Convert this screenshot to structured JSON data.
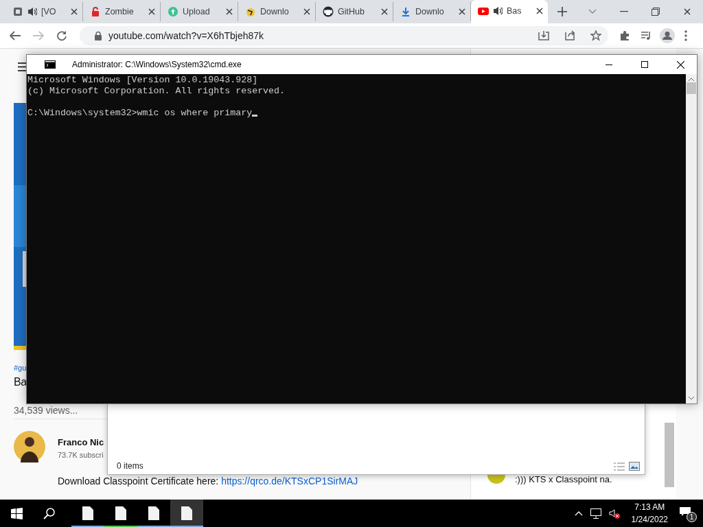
{
  "browser": {
    "tabs": [
      {
        "label": "[VO",
        "audio": true,
        "selected": false
      },
      {
        "label": "Zombie",
        "audio": false,
        "selected": false
      },
      {
        "label": "Upload",
        "audio": false,
        "selected": false
      },
      {
        "label": "Downlo",
        "audio": false,
        "selected": false
      },
      {
        "label": "GitHub",
        "audio": false,
        "selected": false
      },
      {
        "label": "Downlo",
        "audio": false,
        "selected": false
      },
      {
        "label": "Bas",
        "audio": true,
        "selected": true
      }
    ],
    "address": "youtube.com/watch?v=X6hTbjeh87k"
  },
  "page": {
    "hashtag": "#gu",
    "title": "Ba",
    "views": "34,539 views...",
    "channel": {
      "name": "Franco Nic",
      "subscribers": "73.7K subscri"
    },
    "description": [
      {
        "text": "Download Classpoint Certificate here: ",
        "link": "https://qrco.de/KTSxCP1SirMAJ"
      }
    ],
    "chat": {
      "message": ":))) KTS x Classpoint na."
    }
  },
  "cmd_window": {
    "title": "Administrator: C:\\Windows\\System32\\cmd.exe",
    "output_lines": [
      "Microsoft Windows [Version 10.0.19043.928]",
      "(c) Microsoft Corporation. All rights reserved."
    ],
    "prompt": "C:\\Windows\\system32>",
    "command": "wmic os where primary"
  },
  "explorer_window": {
    "status": "0 items"
  },
  "taskbar": {
    "apps": [
      {
        "color": "#7aa7d6",
        "selected": false
      },
      {
        "color": "#4cc24c",
        "selected": false
      },
      {
        "color": "#7aa7d6",
        "selected": false
      },
      {
        "color": "#7aa7d6",
        "selected": true
      }
    ],
    "time": "7:13 AM",
    "date": "1/24/2022",
    "notifications": "1"
  }
}
